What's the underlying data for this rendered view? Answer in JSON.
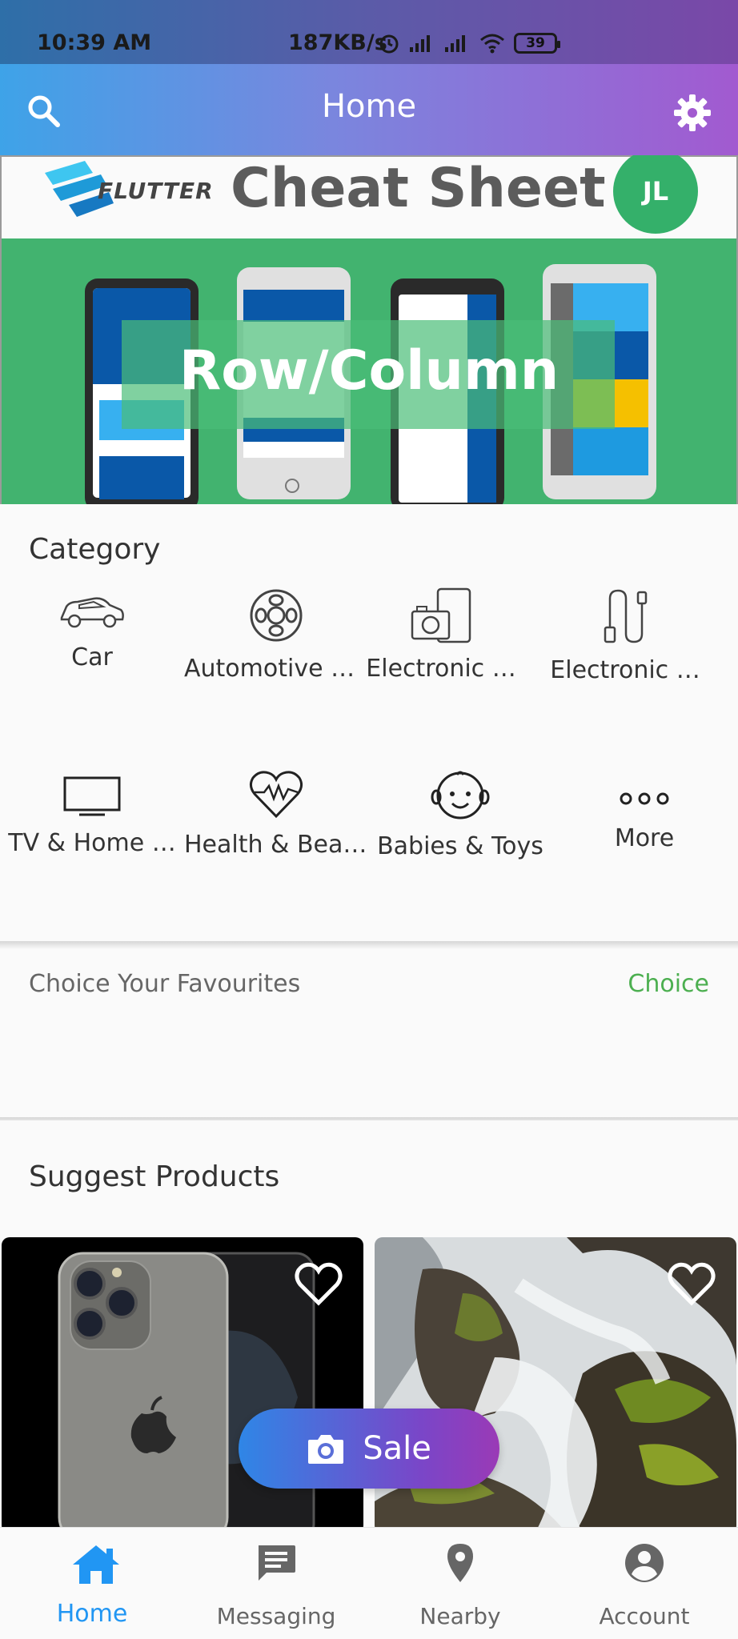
{
  "status_bar": {
    "time": "10:39 AM",
    "network_speed": "187KB/s",
    "battery": "39"
  },
  "app_bar": {
    "title": "Home",
    "left_icon": "search-icon",
    "right_icon": "gear-icon"
  },
  "banner": {
    "brand": "FLUTTER",
    "heading": "Cheat Sheet",
    "badge": "JL",
    "overlay_text": "Row/Column"
  },
  "category": {
    "title": "Category",
    "items": [
      {
        "label": "Car",
        "icon": "car-icon"
      },
      {
        "label": "Automotive & …",
        "icon": "wheel-icon"
      },
      {
        "label": "Electronic …",
        "icon": "camera-phone-icon"
      },
      {
        "label": "Electronic …",
        "icon": "cable-icon"
      },
      {
        "label": "TV & Home …",
        "icon": "tv-icon"
      },
      {
        "label": "Health & Beauty",
        "icon": "heart-pulse-icon"
      },
      {
        "label": "Babies & Toys",
        "icon": "baby-face-icon"
      },
      {
        "label": "More",
        "icon": "more-icon"
      }
    ]
  },
  "favourites": {
    "label": "Choice Your Favourites",
    "action": "Choice"
  },
  "suggest": {
    "title": "Suggest Products"
  },
  "sale_button": {
    "label": "Sale",
    "icon": "camera-icon"
  },
  "bottom_nav": {
    "items": [
      {
        "label": "Home",
        "icon": "home-icon",
        "active": true
      },
      {
        "label": "Messaging",
        "icon": "message-icon",
        "active": false
      },
      {
        "label": "Nearby",
        "icon": "location-pin-icon",
        "active": false
      },
      {
        "label": "Account",
        "icon": "account-icon",
        "active": false
      }
    ]
  },
  "colors": {
    "accent": "#2196f3",
    "choice": "#4caf50",
    "banner_green": "#42b36f"
  }
}
